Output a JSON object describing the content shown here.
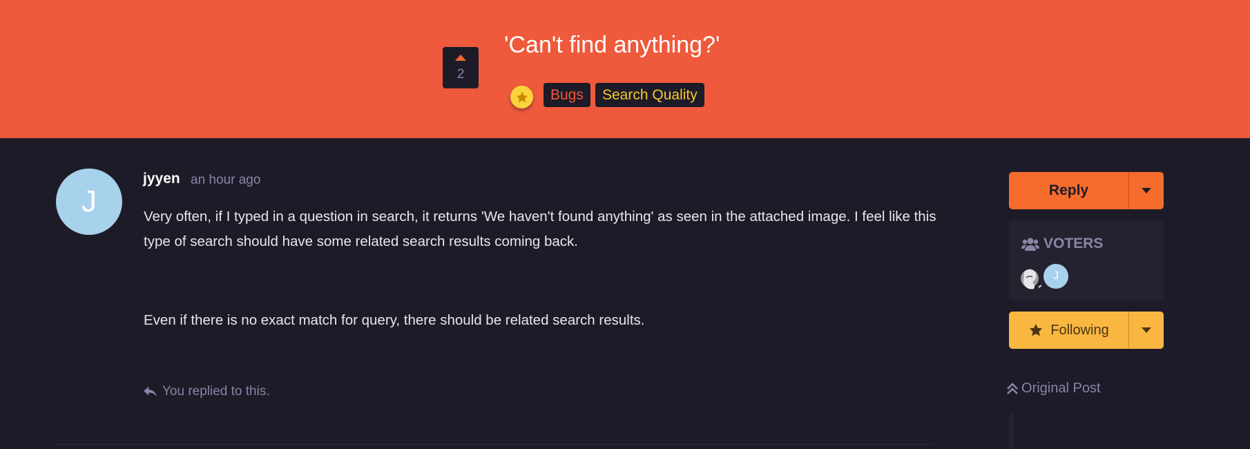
{
  "topic": {
    "title": "'Can't find anything?'",
    "vote_count": "2",
    "tags": [
      "Bugs",
      "Search Quality"
    ]
  },
  "post": {
    "author": "jyyen",
    "avatar_letter": "J",
    "time": "an hour ago",
    "paragraphs": [
      "Very often, if I typed in a question in search, it returns 'We haven't found anything' as seen in the attached image. I feel like this type of search should have some related search results coming back.",
      "Even if there is no exact match for query, there should be related search results."
    ],
    "replied_note": "You replied to this."
  },
  "sidebar": {
    "reply_label": "Reply",
    "voters_title": "VOTERS",
    "voter_letter": "J",
    "following_label": "Following",
    "original_post_label": "Original Post"
  },
  "colors": {
    "header_bg": "#ee5a3b",
    "page_bg": "#1e1b29",
    "reply_button": "#f66c2c",
    "following_button": "#f9b741",
    "tag_bugs": "#ef5a3c",
    "tag_search_quality": "#f8c928"
  },
  "icons": [
    "upvote-arrow-icon",
    "star-icon",
    "users-icon",
    "reply-icon",
    "chevron-down-icon",
    "double-chevron-up-icon"
  ]
}
